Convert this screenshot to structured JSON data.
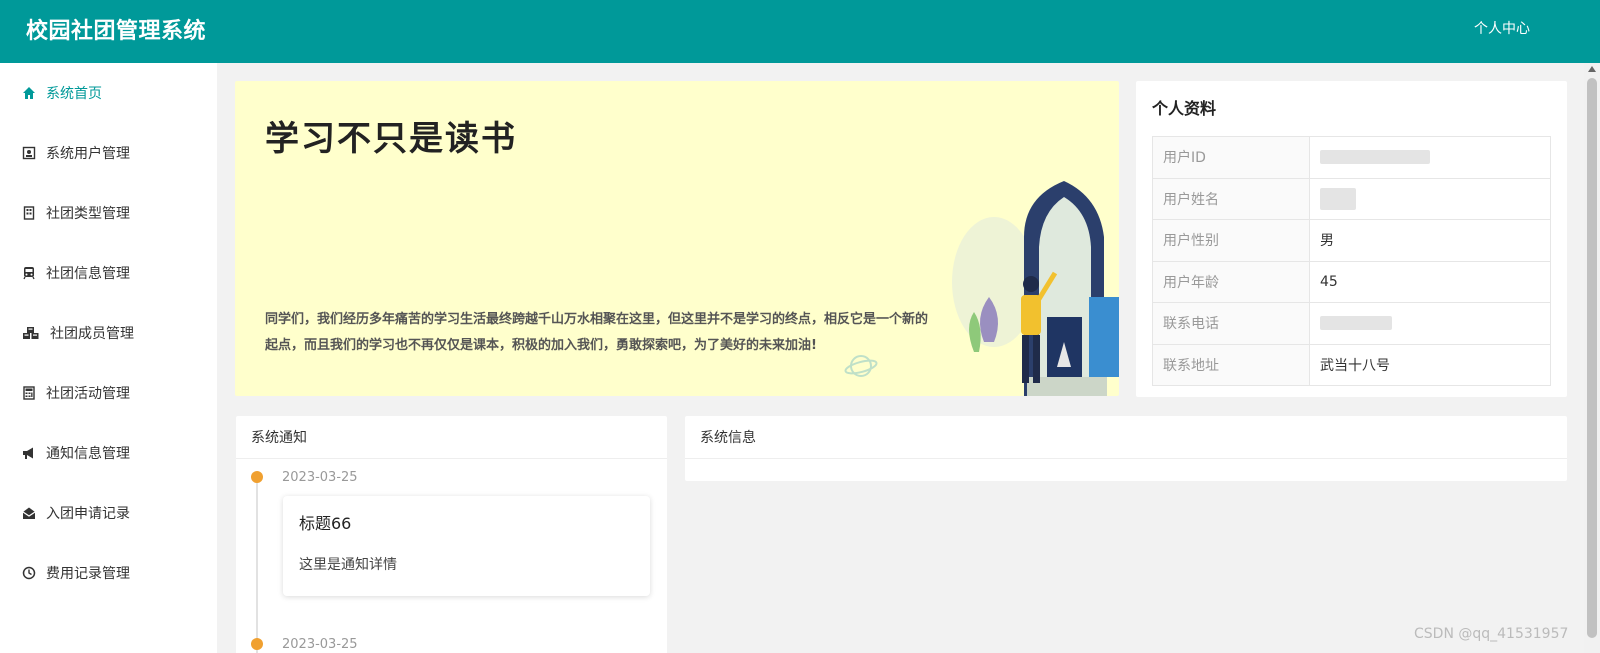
{
  "header": {
    "app_title": "校园社团管理系统",
    "user_center": "个人中心",
    "bg_color": "#009999"
  },
  "sidebar": {
    "items": [
      {
        "label": "系统首页",
        "icon": "home-icon",
        "active": true
      },
      {
        "label": "系统用户管理",
        "icon": "contact-card-icon"
      },
      {
        "label": "社团类型管理",
        "icon": "building-icon"
      },
      {
        "label": "社团信息管理",
        "icon": "train-icon"
      },
      {
        "label": "社团成员管理",
        "icon": "cubes-icon"
      },
      {
        "label": "社团活动管理",
        "icon": "calculator-icon"
      },
      {
        "label": "通知信息管理",
        "icon": "megaphone-icon"
      },
      {
        "label": "入团申请记录",
        "icon": "envelope-open-icon"
      },
      {
        "label": "费用记录管理",
        "icon": "clock-icon"
      }
    ]
  },
  "banner": {
    "title": "学习不只是读书",
    "text": "同学们，我们经历多年痛苦的学习生活最终跨越千山万水相聚在这里，但这里并不是学习的终点，相反它是一个新的起点，而且我们的学习也不再仅仅是课本，积极的加入我们，勇敢探索吧，为了美好的未来加油!"
  },
  "profile": {
    "title": "个人资料",
    "rows": [
      {
        "label": "用户ID",
        "value": ""
      },
      {
        "label": "用户姓名",
        "value": ""
      },
      {
        "label": "用户性别",
        "value": "男"
      },
      {
        "label": "用户年龄",
        "value": "45"
      },
      {
        "label": "联系电话",
        "value": ""
      },
      {
        "label": "联系地址",
        "value": "武当十八号"
      }
    ]
  },
  "notice": {
    "title": "系统通知",
    "items": [
      {
        "date": "2023-03-25",
        "card_title": "标题66",
        "card_body": "这里是通知详情"
      },
      {
        "date": "2023-03-25"
      }
    ]
  },
  "sysinfo": {
    "title": "系统信息"
  },
  "watermark": "CSDN @qq_41531957"
}
